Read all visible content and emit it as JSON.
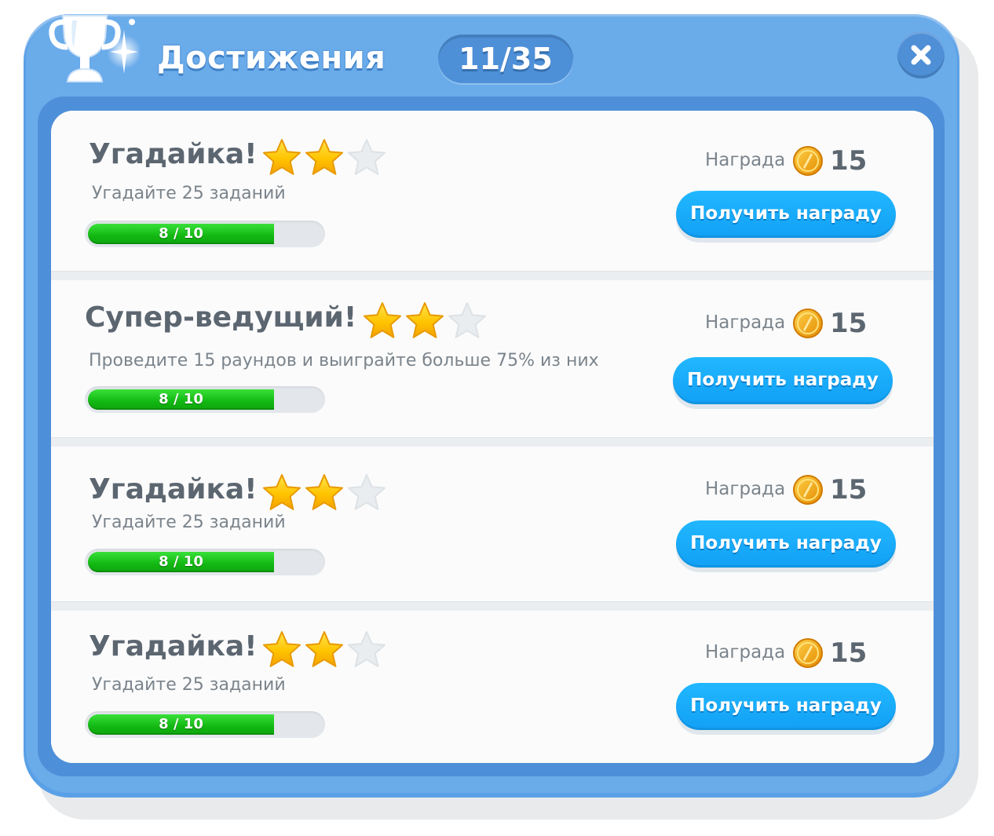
{
  "header": {
    "title": "Достижения",
    "counter": "11/35",
    "close_icon": "close-x-icon",
    "trophy_icon": "trophy-icon"
  },
  "colors": {
    "frame": "#5aa0e6",
    "button": "#1aa9fb",
    "progress": "#12b812",
    "star_on": "#ffc000",
    "star_off": "#e9edf0"
  },
  "achievements": [
    {
      "title": "Угадайка!",
      "stars_earned": 2,
      "stars_total": 3,
      "description": "Угадайте 25 заданий",
      "progress_text": "8 / 10",
      "progress_fraction": 0.8,
      "reward_label": "Награда",
      "reward_value": "15",
      "button_label": "Получить награду"
    },
    {
      "title": "Супер-ведущий!",
      "stars_earned": 2,
      "stars_total": 3,
      "description": "Проведите 15 раундов и выиграйте больше 75% из них",
      "progress_text": "8 / 10",
      "progress_fraction": 0.8,
      "reward_label": "Награда",
      "reward_value": "15",
      "button_label": "Получить награду"
    },
    {
      "title": "Угадайка!",
      "stars_earned": 2,
      "stars_total": 3,
      "description": "Угадайте 25 заданий",
      "progress_text": "8 / 10",
      "progress_fraction": 0.8,
      "reward_label": "Награда",
      "reward_value": "15",
      "button_label": "Получить награду"
    },
    {
      "title": "Угадайка!",
      "stars_earned": 2,
      "stars_total": 3,
      "description": "Угадайте 25 заданий",
      "progress_text": "8 / 10",
      "progress_fraction": 0.8,
      "reward_label": "Награда",
      "reward_value": "15",
      "button_label": "Получить награду"
    }
  ]
}
